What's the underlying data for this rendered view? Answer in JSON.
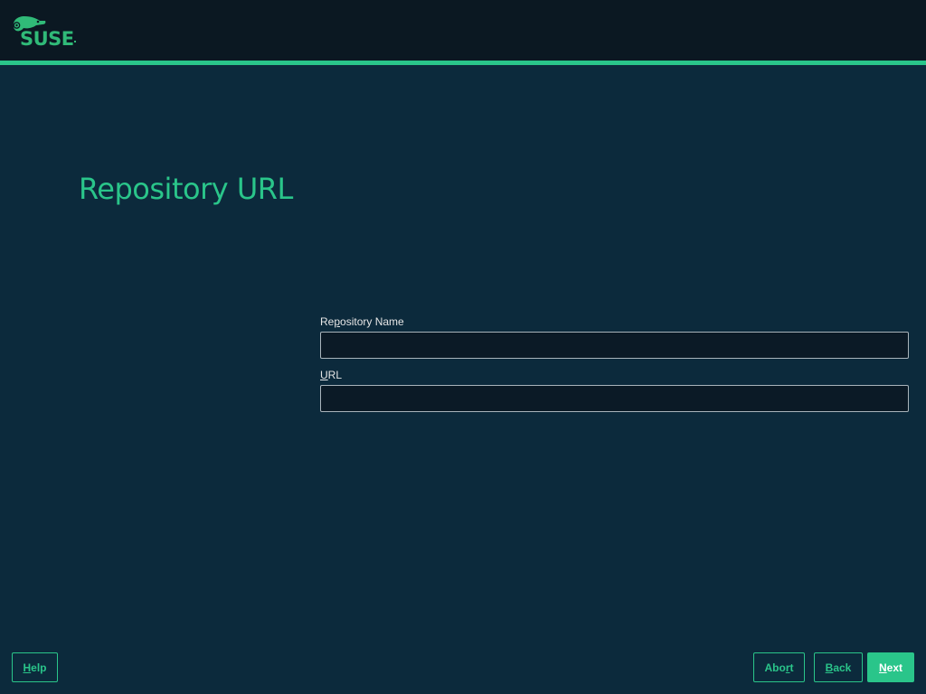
{
  "header": {
    "brand": "SUSE",
    "logo_icon": "suse-chameleon-icon",
    "accent_color": "#2ac58a",
    "background_color": "#0b1822"
  },
  "page": {
    "title": "Repository URL",
    "background_color": "#0c2a3c"
  },
  "form": {
    "repository_name": {
      "label_pre": "Re",
      "label_mnemonic": "p",
      "label_post": "ository Name",
      "value": ""
    },
    "url": {
      "label_pre": "",
      "label_mnemonic": "U",
      "label_post": "RL",
      "value": ""
    }
  },
  "footer": {
    "help": {
      "mnemonic": "H",
      "rest": "elp"
    },
    "abort": {
      "pre": "Abo",
      "mnemonic": "r",
      "post": "t"
    },
    "back": {
      "mnemonic": "B",
      "rest": "ack"
    },
    "next": {
      "mnemonic": "N",
      "rest": "ext"
    }
  }
}
